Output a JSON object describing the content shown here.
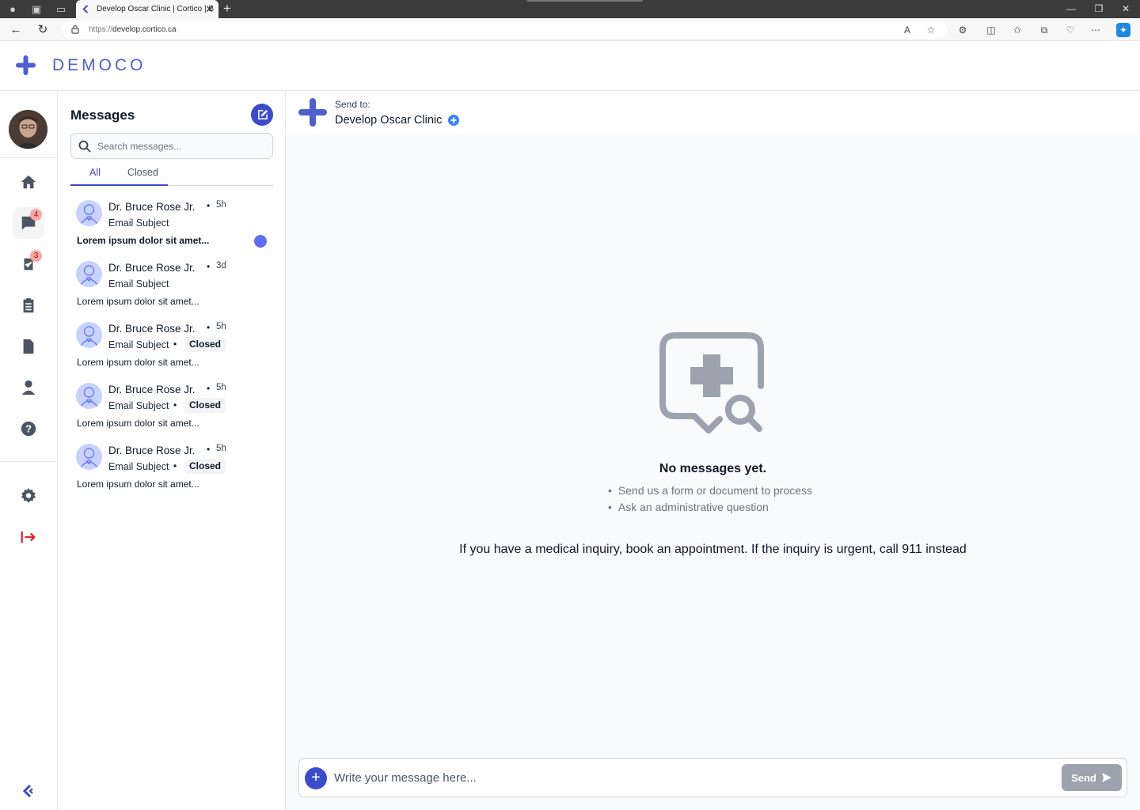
{
  "browser": {
    "tab_title": "Develop Oscar Clinic | Cortico | B",
    "url_protocol": "https://",
    "url_host": "develop.cortico.ca",
    "read_aloud_label": "A",
    "new_tab_label": "+",
    "close_tab_label": "✕"
  },
  "app": {
    "brand": "DEMOCO",
    "accent_color": "#3b4cc9"
  },
  "rail": {
    "items": [
      {
        "name": "home",
        "icon": "home-icon"
      },
      {
        "name": "messages",
        "icon": "chat-icon",
        "badge": "4",
        "active": true
      },
      {
        "name": "tasks",
        "icon": "checklist-icon",
        "badge": "3"
      },
      {
        "name": "forms",
        "icon": "clipboard-icon"
      },
      {
        "name": "documents",
        "icon": "document-icon"
      },
      {
        "name": "profile",
        "icon": "person-icon"
      },
      {
        "name": "help",
        "icon": "help-icon"
      },
      {
        "name": "settings",
        "icon": "gear-icon"
      },
      {
        "name": "logout",
        "icon": "logout-icon"
      }
    ]
  },
  "messages": {
    "title": "Messages",
    "search_placeholder": "Search messages...",
    "tabs": [
      "All",
      "Closed"
    ],
    "conversations": [
      {
        "name": "Dr. Bruce Rose Jr.",
        "time": "5h",
        "subject": "Email Subject",
        "status": "",
        "preview": "Lorem ipsum dolor sit amet...",
        "unread": true
      },
      {
        "name": "Dr. Bruce Rose Jr.",
        "time": "3d",
        "subject": "Email Subject",
        "status": "",
        "preview": "Lorem ipsum dolor sit amet...",
        "unread": false
      },
      {
        "name": "Dr. Bruce Rose Jr.",
        "time": "5h",
        "subject": "Email Subject",
        "status": "Closed",
        "preview": "Lorem ipsum dolor sit amet...",
        "unread": false
      },
      {
        "name": "Dr. Bruce Rose Jr.",
        "time": "5h",
        "subject": "Email Subject",
        "status": "Closed",
        "preview": "Lorem ipsum dolor sit amet...",
        "unread": false
      },
      {
        "name": "Dr. Bruce Rose Jr.",
        "time": "5h",
        "subject": "Email Subject",
        "status": "Closed",
        "preview": "Lorem ipsum dolor sit amet...",
        "unread": false
      }
    ]
  },
  "conversation": {
    "send_to_label": "Send to:",
    "clinic_name": "Develop Oscar Clinic",
    "empty_title": "No messages yet.",
    "empty_points": [
      "Send us a form or document to process",
      "Ask an administrative question"
    ],
    "inquiry_note": "If you have a medical inquiry, book an appointment. If the inquiry is urgent, call 911 instead",
    "composer_placeholder": "Write your message here...",
    "send_label": "Send"
  }
}
